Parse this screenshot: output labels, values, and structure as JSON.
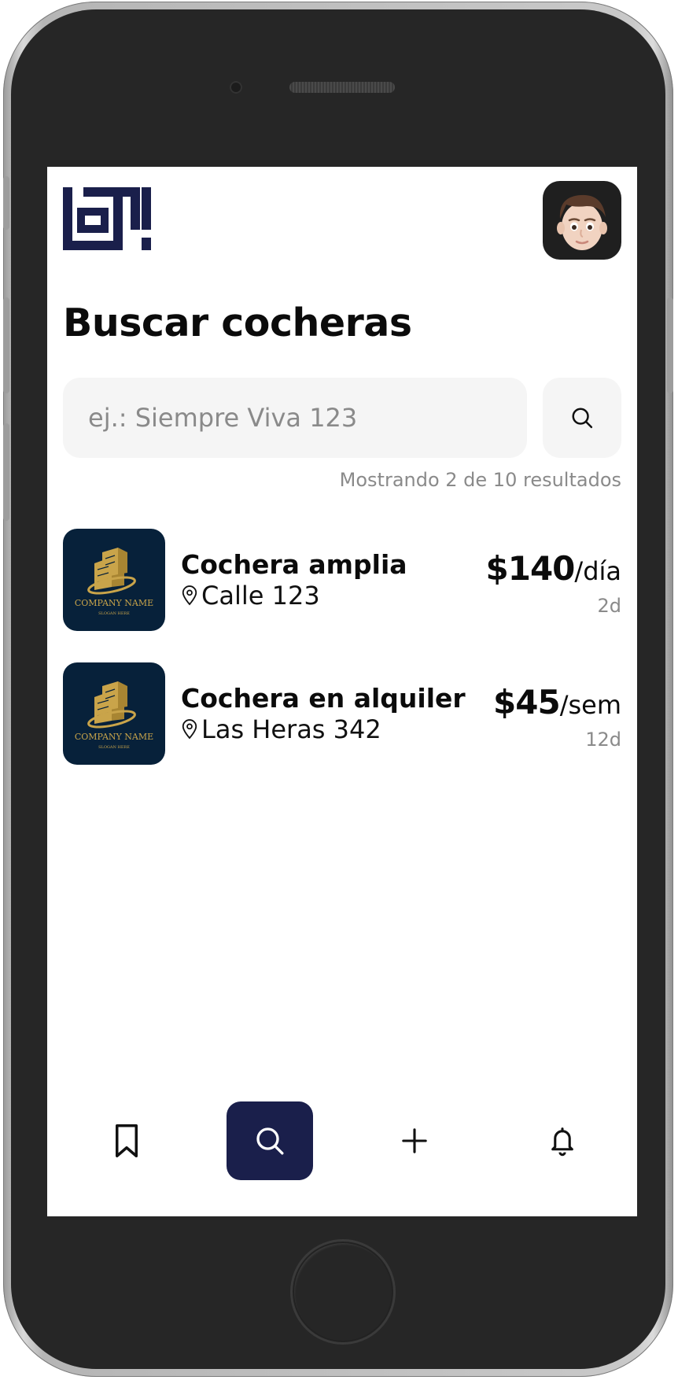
{
  "app": {
    "colors": {
      "brand_navy": "#1a1f4b",
      "text_primary": "#0b0b0b",
      "text_muted": "#8a8a8a",
      "input_bg": "#f5f5f5",
      "thumb_bg": "#07213a",
      "thumb_gold": "#c9a44a"
    }
  },
  "header": {
    "logo_icon": "loti-logo",
    "avatar_icon": "memoji-avatar"
  },
  "page": {
    "title": "Buscar cocheras"
  },
  "search": {
    "placeholder": "ej.: Siempre Viva 123",
    "value": "",
    "button_icon": "search-icon"
  },
  "results": {
    "summary": "Mostrando 2 de 10 resultados",
    "items": [
      {
        "title": "Cochera amplia",
        "address": "Calle 123",
        "price": "$140",
        "unit": "/día",
        "age": "2d",
        "thumb_text": "COMPANY NAME",
        "thumb_slogan": "SLOGAN HERE"
      },
      {
        "title": "Cochera en alquiler",
        "address": "Las Heras 342",
        "price": "$45",
        "unit": "/sem",
        "age": "12d",
        "thumb_text": "COMPANY NAME",
        "thumb_slogan": "SLOGAN HERE"
      }
    ]
  },
  "bottom_nav": {
    "items": [
      {
        "icon": "bookmark-icon",
        "active": false
      },
      {
        "icon": "search-icon",
        "active": true
      },
      {
        "icon": "plus-icon",
        "active": false
      },
      {
        "icon": "bell-icon",
        "active": false
      }
    ]
  }
}
